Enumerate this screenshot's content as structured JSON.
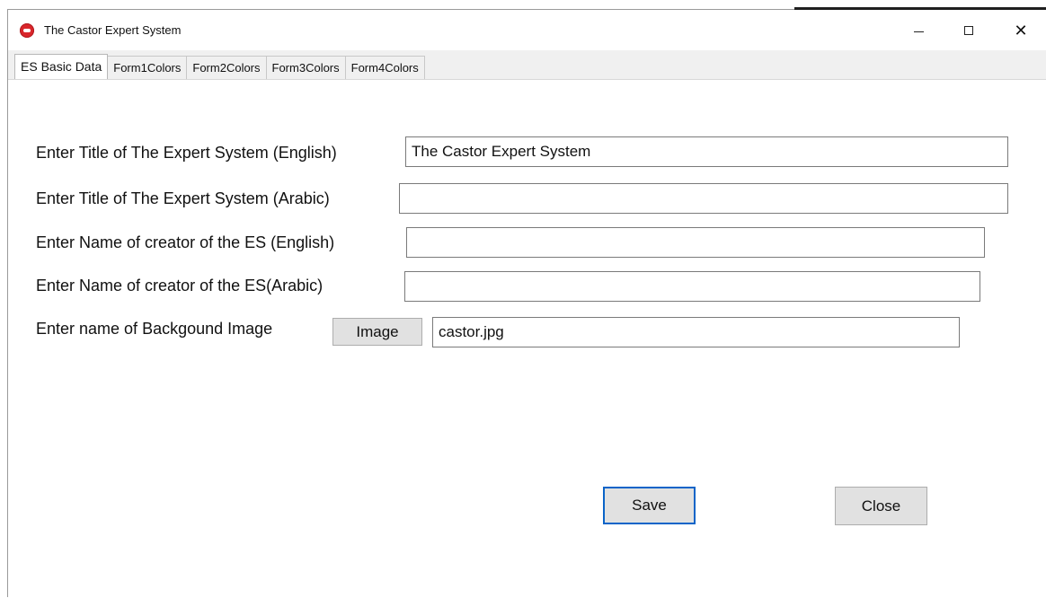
{
  "window": {
    "title": "The Castor Expert System",
    "controls": {
      "minimize_icon": "minimize-icon",
      "maximize_icon": "maximize-icon",
      "close_glyph": "✕"
    }
  },
  "tabs": [
    {
      "label": "ES Basic Data",
      "active": true
    },
    {
      "label": "Form1Colors",
      "active": false
    },
    {
      "label": "Form2Colors",
      "active": false
    },
    {
      "label": "Form3Colors",
      "active": false
    },
    {
      "label": "Form4Colors",
      "active": false
    }
  ],
  "form": {
    "title_english": {
      "label": "Enter Title of The Expert System (English)",
      "value": "The Castor Expert System"
    },
    "title_arabic": {
      "label": "Enter Title of The Expert System (Arabic)",
      "value": ""
    },
    "creator_english": {
      "label": "Enter Name of creator of the ES (English)",
      "value": ""
    },
    "creator_arabic": {
      "label": "Enter Name of creator of the ES(Arabic)",
      "value": ""
    },
    "background_image": {
      "label": "Enter name of Backgound Image",
      "button_label": "Image",
      "value": "castor.jpg"
    }
  },
  "actions": {
    "save_label": "Save",
    "close_label": "Close"
  },
  "colors": {
    "app_icon": "#d9262b",
    "focus_border": "#0a64c8",
    "button_face": "#e1e1e1"
  }
}
